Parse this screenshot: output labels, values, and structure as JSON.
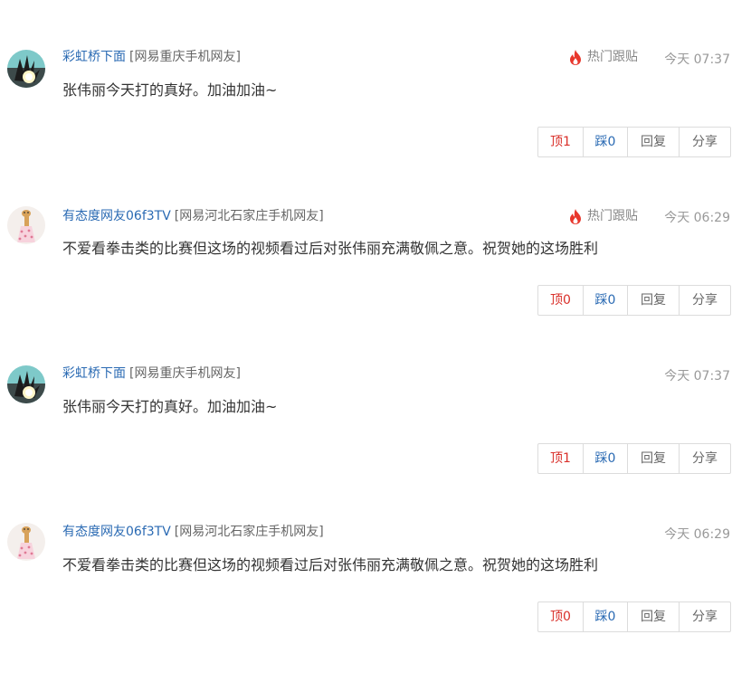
{
  "comments": [
    {
      "username": "彩虹桥下面",
      "location": "[网易重庆手机网友]",
      "hot": "热门跟贴",
      "time": "今天 07:37",
      "content": "张伟丽今天打的真好。加油加油~",
      "up_label": "顶1",
      "down_label": "踩0",
      "reply_label": "回复",
      "share_label": "分享",
      "avatar_icon": "hand-light-avatar-icon"
    },
    {
      "username": "有态度网友06f3TV",
      "location": "[网易河北石家庄手机网友]",
      "hot": "热门跟贴",
      "time": "今天 06:29",
      "content": "不爱看拳击类的比赛但这场的视频看过后对张伟丽充满敬佩之意。祝贺她的这场胜利",
      "up_label": "顶0",
      "down_label": "踩0",
      "reply_label": "回复",
      "share_label": "分享",
      "avatar_icon": "giraffe-avatar-icon"
    },
    {
      "username": "彩虹桥下面",
      "location": "[网易重庆手机网友]",
      "time": "今天 07:37",
      "content": "张伟丽今天打的真好。加油加油~",
      "up_label": "顶1",
      "down_label": "踩0",
      "reply_label": "回复",
      "share_label": "分享",
      "avatar_icon": "hand-light-avatar-icon"
    },
    {
      "username": "有态度网友06f3TV",
      "location": "[网易河北石家庄手机网友]",
      "time": "今天 06:29",
      "content": "不爱看拳击类的比赛但这场的视频看过后对张伟丽充满敬佩之意。祝贺她的这场胜利",
      "up_label": "顶0",
      "down_label": "踩0",
      "reply_label": "回复",
      "share_label": "分享",
      "avatar_icon": "giraffe-avatar-icon"
    }
  ],
  "colors": {
    "username": "#2a6ab3",
    "hot_flame": "#e8372c",
    "up": "#d9302a",
    "down": "#2a6ab3"
  }
}
